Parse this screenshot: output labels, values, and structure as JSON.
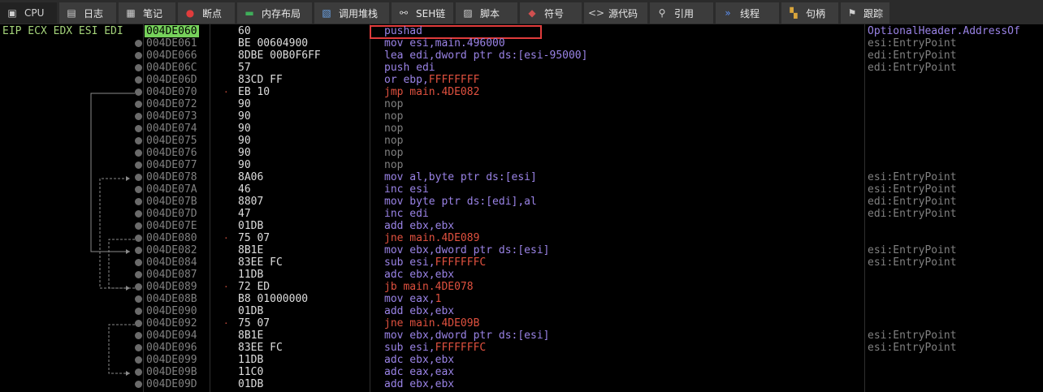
{
  "tabs": [
    {
      "label": "CPU",
      "icon": "cpu-icon",
      "active": true
    },
    {
      "label": "日志",
      "icon": "log-icon"
    },
    {
      "label": "笔记",
      "icon": "notes-icon"
    },
    {
      "label": "断点",
      "icon": "breakpoint-icon"
    },
    {
      "label": "内存布局",
      "icon": "memory-map-icon"
    },
    {
      "label": "调用堆栈",
      "icon": "call-stack-icon"
    },
    {
      "label": "SEH链",
      "icon": "seh-icon"
    },
    {
      "label": "脚本",
      "icon": "script-icon"
    },
    {
      "label": "符号",
      "icon": "symbol-icon"
    },
    {
      "label": "源代码",
      "icon": "source-icon"
    },
    {
      "label": "引用",
      "icon": "references-icon"
    },
    {
      "label": "线程",
      "icon": "threads-icon"
    },
    {
      "label": "句柄",
      "icon": "handles-icon"
    },
    {
      "label": "跟踪",
      "icon": "trace-icon"
    }
  ],
  "registers_label": "EIP ECX EDX ESI EDI",
  "rows": [
    {
      "addr": "004DE060",
      "bytes": "60",
      "instr": [
        [
          "pushad",
          "#9a83e6"
        ]
      ],
      "comment": "OptionalHeader.AddressOf"
    },
    {
      "addr": "004DE061",
      "bytes": "BE 00604900",
      "instr": [
        [
          "mov esi,main.496000",
          "#9a83e6"
        ]
      ],
      "comment": "esi:EntryPoint"
    },
    {
      "addr": "004DE066",
      "bytes": "8DBE 00B0F6FF",
      "instr": [
        [
          "lea edi,dword ptr ds:[esi-95000]",
          "#9a83e6"
        ]
      ],
      "comment": "edi:EntryPoint"
    },
    {
      "addr": "004DE06C",
      "bytes": "57",
      "instr": [
        [
          "push edi",
          "#9a83e6"
        ]
      ],
      "comment": "edi:EntryPoint"
    },
    {
      "addr": "004DE06D",
      "bytes": "83CD FF",
      "instr": [
        [
          "or ebp,",
          "#9a83e6"
        ],
        [
          "FFFFFFFF",
          "#e0513f"
        ]
      ],
      "comment": ""
    },
    {
      "addr": "004DE070",
      "bytes": "EB 10",
      "marker": "·",
      "instr": [
        [
          "jmp main.4DE082",
          "#e0513f"
        ]
      ],
      "comment": ""
    },
    {
      "addr": "004DE072",
      "bytes": "90",
      "instr": [
        [
          "nop",
          "#808080"
        ]
      ],
      "comment": ""
    },
    {
      "addr": "004DE073",
      "bytes": "90",
      "instr": [
        [
          "nop",
          "#808080"
        ]
      ],
      "comment": ""
    },
    {
      "addr": "004DE074",
      "bytes": "90",
      "instr": [
        [
          "nop",
          "#808080"
        ]
      ],
      "comment": ""
    },
    {
      "addr": "004DE075",
      "bytes": "90",
      "instr": [
        [
          "nop",
          "#808080"
        ]
      ],
      "comment": ""
    },
    {
      "addr": "004DE076",
      "bytes": "90",
      "instr": [
        [
          "nop",
          "#808080"
        ]
      ],
      "comment": ""
    },
    {
      "addr": "004DE077",
      "bytes": "90",
      "instr": [
        [
          "nop",
          "#808080"
        ]
      ],
      "comment": ""
    },
    {
      "addr": "004DE078",
      "bytes": "8A06",
      "instr": [
        [
          "mov al,byte ptr ds:[esi]",
          "#9a83e6"
        ]
      ],
      "comment": "esi:EntryPoint"
    },
    {
      "addr": "004DE07A",
      "bytes": "46",
      "instr": [
        [
          "inc esi",
          "#9a83e6"
        ]
      ],
      "comment": "esi:EntryPoint"
    },
    {
      "addr": "004DE07B",
      "bytes": "8807",
      "instr": [
        [
          "mov byte ptr ds:[edi],al",
          "#9a83e6"
        ]
      ],
      "comment": "edi:EntryPoint"
    },
    {
      "addr": "004DE07D",
      "bytes": "47",
      "instr": [
        [
          "inc edi",
          "#9a83e6"
        ]
      ],
      "comment": "edi:EntryPoint"
    },
    {
      "addr": "004DE07E",
      "bytes": "01DB",
      "instr": [
        [
          "add ebx,ebx",
          "#9a83e6"
        ]
      ],
      "comment": ""
    },
    {
      "addr": "004DE080",
      "bytes": "75 07",
      "marker": "·",
      "instr": [
        [
          "jne main.4DE089",
          "#e0513f"
        ]
      ],
      "comment": ""
    },
    {
      "addr": "004DE082",
      "bytes": "8B1E",
      "instr": [
        [
          "mov ebx,dword ptr ds:[esi]",
          "#9a83e6"
        ]
      ],
      "comment": "esi:EntryPoint"
    },
    {
      "addr": "004DE084",
      "bytes": "83EE FC",
      "instr": [
        [
          "sub esi,",
          "#9a83e6"
        ],
        [
          "FFFFFFFC",
          "#e0513f"
        ]
      ],
      "comment": "esi:EntryPoint"
    },
    {
      "addr": "004DE087",
      "bytes": "11DB",
      "instr": [
        [
          "adc ebx,ebx",
          "#9a83e6"
        ]
      ],
      "comment": ""
    },
    {
      "addr": "004DE089",
      "bytes": "72 ED",
      "marker": "·",
      "instr": [
        [
          "jb main.4DE078",
          "#e0513f"
        ]
      ],
      "comment": ""
    },
    {
      "addr": "004DE08B",
      "bytes": "B8 01000000",
      "instr": [
        [
          "mov eax,",
          "#9a83e6"
        ],
        [
          "1",
          "#e0513f"
        ]
      ],
      "comment": ""
    },
    {
      "addr": "004DE090",
      "bytes": "01DB",
      "instr": [
        [
          "add ebx,ebx",
          "#9a83e6"
        ]
      ],
      "comment": ""
    },
    {
      "addr": "004DE092",
      "bytes": "75 07",
      "marker": "·",
      "instr": [
        [
          "jne main.4DE09B",
          "#e0513f"
        ]
      ],
      "comment": ""
    },
    {
      "addr": "004DE094",
      "bytes": "8B1E",
      "instr": [
        [
          "mov ebx,dword ptr ds:[esi]",
          "#9a83e6"
        ]
      ],
      "comment": "esi:EntryPoint"
    },
    {
      "addr": "004DE096",
      "bytes": "83EE FC",
      "instr": [
        [
          "sub esi,",
          "#9a83e6"
        ],
        [
          "FFFFFFFC",
          "#e0513f"
        ]
      ],
      "comment": "esi:EntryPoint"
    },
    {
      "addr": "004DE099",
      "bytes": "11DB",
      "instr": [
        [
          "adc ebx,ebx",
          "#9a83e6"
        ]
      ],
      "comment": ""
    },
    {
      "addr": "004DE09B",
      "bytes": "11C0",
      "instr": [
        [
          "adc eax,eax",
          "#9a83e6"
        ]
      ],
      "comment": ""
    },
    {
      "addr": "004DE09D",
      "bytes": "01DB",
      "instr": [
        [
          "add ebx,ebx",
          "#9a83e6"
        ]
      ],
      "comment": ""
    }
  ]
}
